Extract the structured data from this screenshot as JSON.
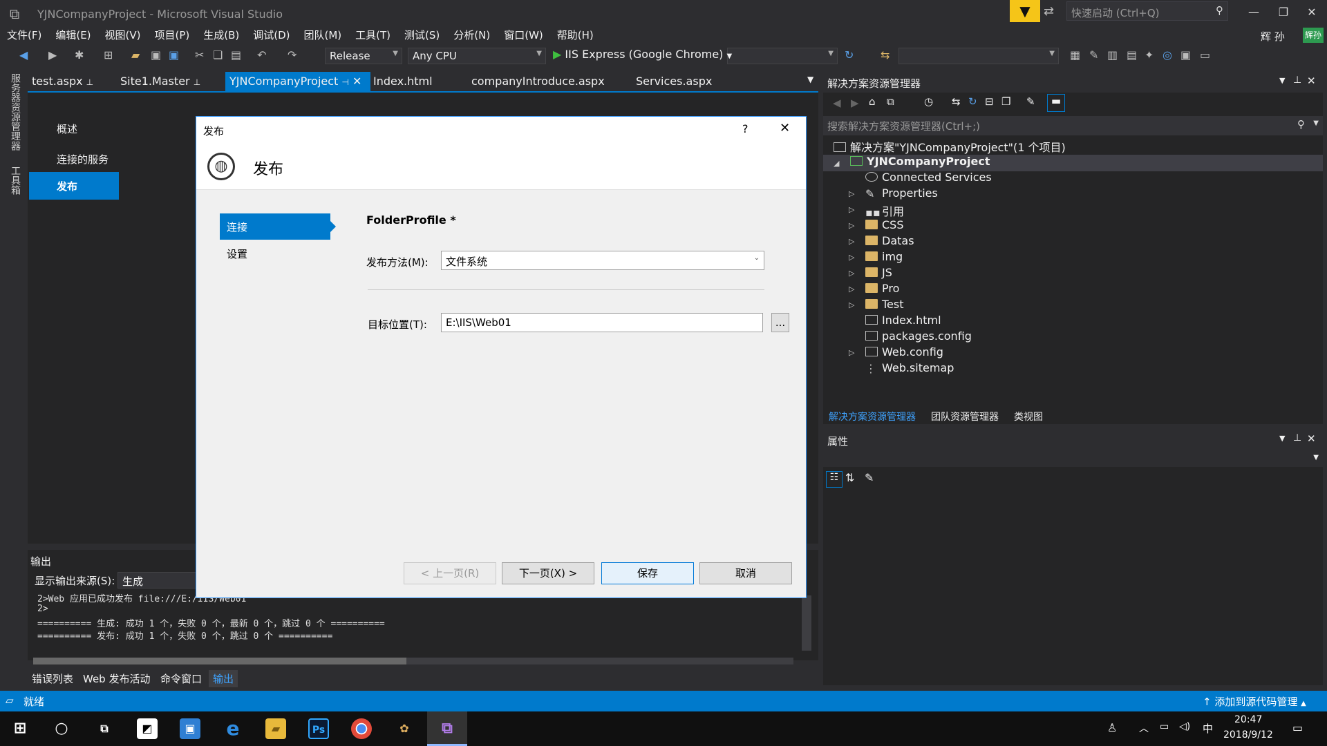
{
  "window": {
    "title": "YJNCompanyProject - Microsoft Visual Studio",
    "quick_launch": "快速启动 (Ctrl+Q)"
  },
  "menu": [
    "文件(F)",
    "编辑(E)",
    "视图(V)",
    "项目(P)",
    "生成(B)",
    "调试(D)",
    "团队(M)",
    "工具(T)",
    "测试(S)",
    "分析(N)",
    "窗口(W)",
    "帮助(H)"
  ],
  "user": {
    "name": "辉 孙",
    "badge": "辉孙"
  },
  "toolbar": {
    "config": "Release",
    "platform": "Any CPU",
    "run": "IIS Express (Google Chrome)"
  },
  "side_strip": [
    "服务器资源管理器",
    "工具箱"
  ],
  "doc_tabs": [
    "test.aspx",
    "Site1.Master",
    "YJNCompanyProject",
    "Index.html",
    "companyIntroduce.aspx",
    "Services.aspx"
  ],
  "editor_nav": [
    "概述",
    "连接的服务",
    "发布"
  ],
  "dialog": {
    "title": "发布",
    "help": "?",
    "header": "发布",
    "nav": [
      "连接",
      "设置"
    ],
    "profile": "FolderProfile *",
    "method_label": "发布方法(M):",
    "method_value": "文件系统",
    "target_label": "目标位置(T):",
    "target_value": "E:\\IIS\\Web01",
    "browse": "...",
    "buttons": [
      "< 上一页(R)",
      "下一页(X) >",
      "保存",
      "取消"
    ]
  },
  "solution": {
    "title": "解决方案资源管理器",
    "search_placeholder": "搜索解决方案资源管理器(Ctrl+;)",
    "root": "解决方案\"YJNCompanyProject\"(1 个项目)",
    "project": "YJNCompanyProject",
    "items": [
      "Connected Services",
      "Properties",
      "引用",
      "CSS",
      "Datas",
      "img",
      "JS",
      "Pro",
      "Test",
      "Index.html",
      "packages.config",
      "Web.config",
      "Web.sitemap"
    ],
    "tabs": [
      "解决方案资源管理器",
      "团队资源管理器",
      "类视图"
    ]
  },
  "properties": {
    "title": "属性"
  },
  "output": {
    "title": "输出",
    "source_label": "显示输出来源(S):",
    "source_value": "生成",
    "lines": [
      "2>Web 应用已成功发布 file:///E:/IIS/Web01",
      "2>",
      "========== 生成: 成功 1 个，失败 0 个，最新 0 个，跳过 0 个 ==========",
      "========== 发布: 成功 1 个，失败 0 个，跳过 0 个 =========="
    ],
    "tabs": [
      "错误列表",
      "Web 发布活动",
      "命令窗口",
      "输出"
    ]
  },
  "status": {
    "left": "就绪",
    "right": "添加到源代码管理"
  },
  "clock": {
    "time": "20:47",
    "date": "2018/9/12",
    "ime": "中"
  }
}
